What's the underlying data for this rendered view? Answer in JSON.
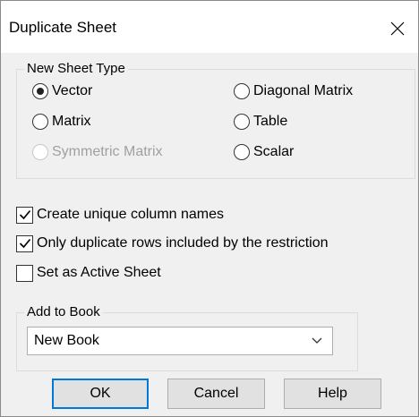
{
  "dialog": {
    "title": "Duplicate Sheet",
    "close_icon": "close-icon"
  },
  "sheet_type": {
    "label": "New Sheet Type",
    "options": [
      {
        "label": "Vector",
        "selected": true,
        "enabled": true
      },
      {
        "label": "Diagonal Matrix",
        "selected": false,
        "enabled": true
      },
      {
        "label": "Matrix",
        "selected": false,
        "enabled": true
      },
      {
        "label": "Table",
        "selected": false,
        "enabled": true
      },
      {
        "label": "Symmetric Matrix",
        "selected": false,
        "enabled": false
      },
      {
        "label": "Scalar",
        "selected": false,
        "enabled": true
      }
    ]
  },
  "checkboxes": [
    {
      "label": "Create unique column names",
      "checked": true
    },
    {
      "label": "Only duplicate rows included by the restriction",
      "checked": true
    },
    {
      "label": "Set as Active Sheet",
      "checked": false
    }
  ],
  "add_to_book": {
    "label": "Add to Book",
    "selected": "New Book",
    "arrow_icon": "chevron-down-icon"
  },
  "buttons": {
    "ok": "OK",
    "cancel": "Cancel",
    "help": "Help"
  },
  "colors": {
    "accent": "#0078d7",
    "disabled_text": "#a0a0a0"
  }
}
